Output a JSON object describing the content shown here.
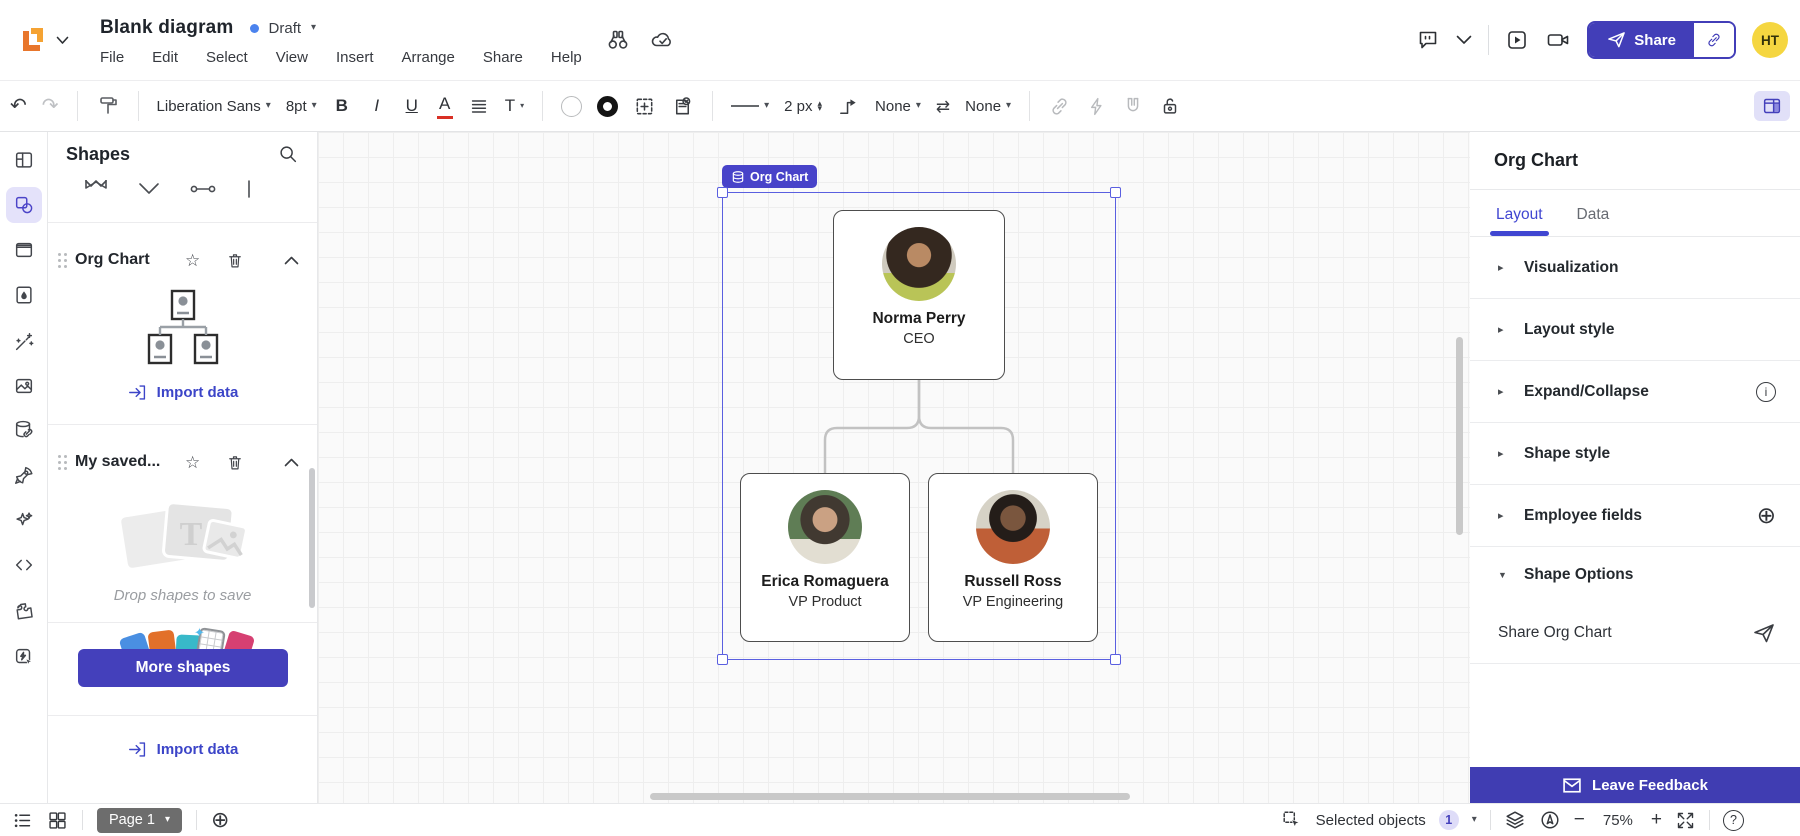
{
  "icons": {
    "caret_down": "▾",
    "stepper_up": "▴",
    "stepper_down": "▾",
    "swap": "⇄",
    "undo": "↶",
    "redo": "↷",
    "star": "☆",
    "plus_circle": "⊕",
    "minus": "−",
    "plus": "+",
    "info": "i",
    "question": "?",
    "triangle_right": "▸",
    "triangle_down": "▼"
  },
  "header": {
    "title": "Blank diagram",
    "status": "Draft",
    "menus": [
      "File",
      "Edit",
      "Select",
      "View",
      "Insert",
      "Arrange",
      "Share",
      "Help"
    ],
    "share_button": "Share",
    "avatar_initials": "HT"
  },
  "toolbar": {
    "font_family": "Liberation Sans",
    "font_size": "8pt",
    "bold": "B",
    "italic": "I",
    "underline": "U",
    "font_color": "A",
    "text_style": "T",
    "line_width": "2 px",
    "arrow_start": "None",
    "arrow_end": "None"
  },
  "shapes_panel": {
    "title": "Shapes",
    "org_chart_section": {
      "title": "Org Chart",
      "import_label": "Import data"
    },
    "saved_section": {
      "title": "My saved...",
      "hint": "Drop shapes to save"
    },
    "more_shapes_button": "More shapes",
    "bottom_import_label": "Import data"
  },
  "canvas": {
    "selection_badge": "Org Chart",
    "nodes": [
      {
        "name": "Norma Perry",
        "title": "CEO"
      },
      {
        "name": "Erica Romaguera",
        "title": "VP Product"
      },
      {
        "name": "Russell Ross",
        "title": "VP Engineering"
      }
    ]
  },
  "right_panel": {
    "title": "Org Chart",
    "tabs": [
      {
        "label": "Layout"
      },
      {
        "label": "Data"
      }
    ],
    "sections": [
      {
        "label": "Visualization"
      },
      {
        "label": "Layout style"
      },
      {
        "label": "Expand/Collapse"
      },
      {
        "label": "Shape style"
      },
      {
        "label": "Employee fields"
      },
      {
        "label": "Shape Options"
      }
    ],
    "share_row_label": "Share Org Chart",
    "feedback_button": "Leave Feedback"
  },
  "bottom_bar": {
    "page_label": "Page 1",
    "selected_objects_label": "Selected objects",
    "selected_count": "1",
    "zoom_level": "75%"
  },
  "colors": {
    "accent": "#4440bb",
    "selection_blue": "#5a5fe0",
    "link_blue": "#3c45c8",
    "draft_dot": "#4b83ee",
    "avatar_yellow": "#f5d640",
    "badge_bg": "#4843c9"
  }
}
